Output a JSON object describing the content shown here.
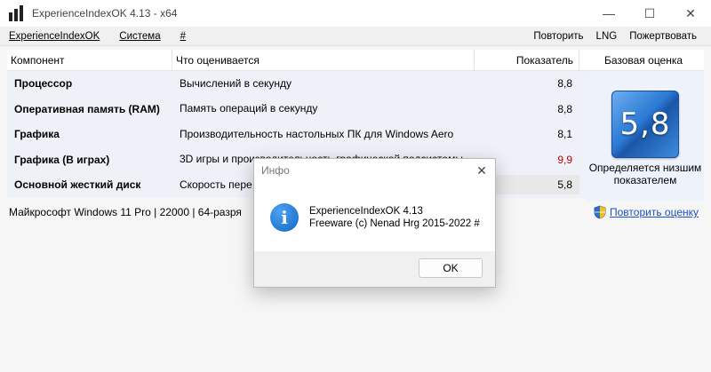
{
  "window": {
    "title": "ExperienceIndexOK 4.13 - x64",
    "min_glyph": "—",
    "max_glyph": "☐",
    "close_glyph": "✕"
  },
  "menu": {
    "left": [
      "ExperienceIndexOK",
      "Система",
      "#"
    ],
    "right": [
      "Повторить",
      "LNG",
      "Пожертвовать"
    ]
  },
  "table": {
    "headers": [
      "Компонент",
      "Что оценивается",
      "Показатель",
      "Базовая оценка"
    ],
    "rows": [
      {
        "component": "Процессор",
        "what": "Вычислений в секунду",
        "score": "8,8"
      },
      {
        "component": "Оперативная память (RAM)",
        "what": "Память операций в секунду",
        "score": "8,8"
      },
      {
        "component": "Графика",
        "what": "Производительность настольных ПК для Windows Aero",
        "score": "8,1"
      },
      {
        "component": "Графика (В играх)",
        "what": "3D игры и производительность графической подсистемы",
        "score": "9,9"
      },
      {
        "component": "Основной жесткий диск",
        "what": "Скорость пере",
        "score": "5,8"
      }
    ]
  },
  "rating": {
    "value": "5,8",
    "caption_line1": "Определяется низшим",
    "caption_line2": "показателем"
  },
  "status": {
    "text": "Майкрософт Windows 11 Pro | 22000 | 64-разря",
    "repeat_link": "Повторить оценку"
  },
  "dialog": {
    "title": "Инфо",
    "line1": "ExperienceIndexOK 4.13",
    "line2": "Freeware (c) Nenad Hrg 2015-2022 #",
    "ok": "OK"
  },
  "colors": {
    "red_score": "#c00000",
    "link": "#1a52c4",
    "tile_blue": "#2b79d4"
  }
}
